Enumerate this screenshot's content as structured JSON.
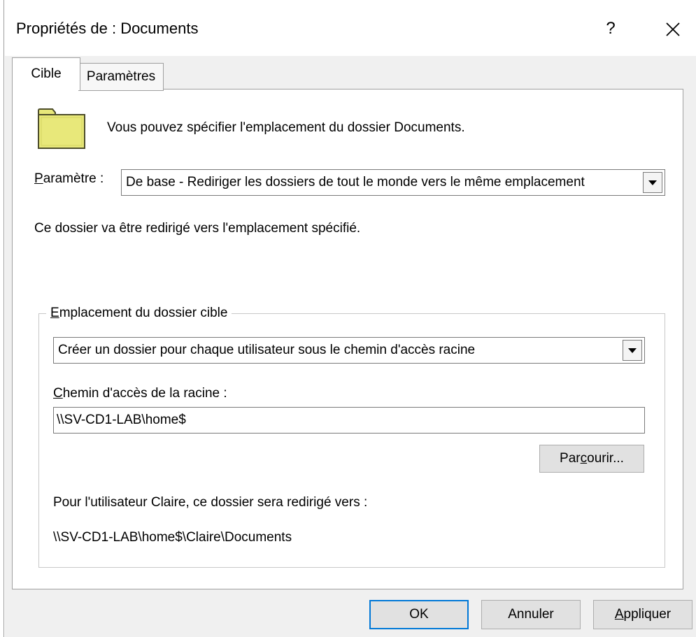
{
  "window": {
    "title": "Propriétés de : Documents",
    "help_label": "?"
  },
  "tabs": [
    {
      "label": "Cible",
      "active": true
    },
    {
      "label": "Paramètres",
      "active": false
    }
  ],
  "target": {
    "intro_text": "Vous pouvez spécifier l'emplacement du dossier Documents.",
    "setting_label_prefix": "P",
    "setting_label_rest": "aramètre :",
    "setting_value": "De base - Rediriger les dossiers de tout le monde vers le même emplacement",
    "redirect_note": "Ce dossier va être redirigé vers l'emplacement spécifié.",
    "group_title_prefix": "E",
    "group_title_rest": "mplacement du dossier cible",
    "location_option": "Créer un dossier pour chaque utilisateur sous le chemin d'accès racine",
    "root_label_prefix": "C",
    "root_label_rest": "hemin d'accès de la racine :",
    "root_path": "\\\\SV-CD1-LAB\\home$",
    "browse_label_pre": "Par",
    "browse_label_key": "c",
    "browse_label_post": "ourir...",
    "user_note": "Pour l'utilisateur Claire, ce dossier sera redirigé vers :",
    "user_path": "\\\\SV-CD1-LAB\\home$\\Claire\\Documents"
  },
  "buttons": {
    "ok": "OK",
    "cancel": "Annuler",
    "apply_key": "A",
    "apply_rest": "ppliquer"
  },
  "colors": {
    "folder_fill": "#e8e87a",
    "folder_stroke": "#4d4d2a",
    "focus_border": "#0078d7"
  }
}
